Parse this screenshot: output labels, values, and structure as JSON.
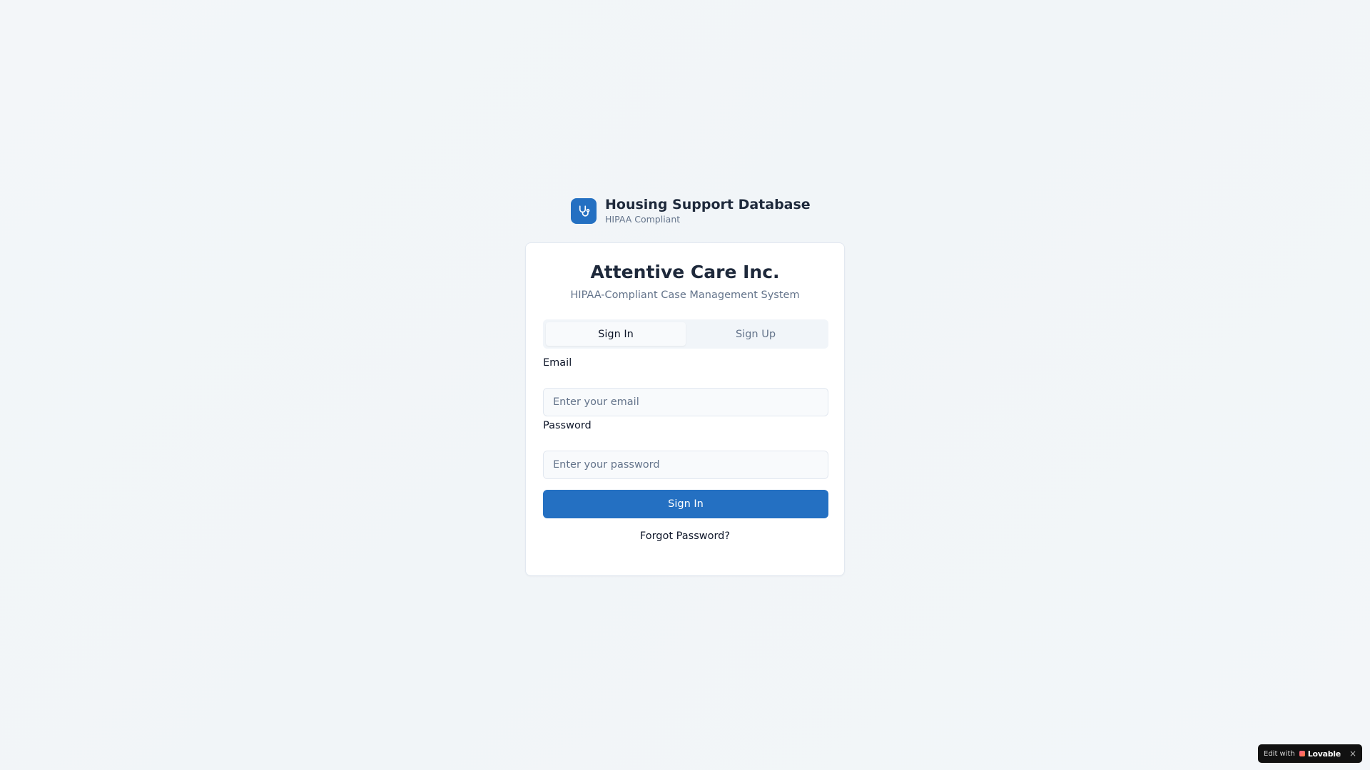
{
  "brand": {
    "icon": "stethoscope-icon",
    "title": "Housing Support Database",
    "subtitle": "HIPAA Compliant"
  },
  "card": {
    "title": "Attentive Care Inc.",
    "subtitle": "HIPAA-Compliant Case Management System"
  },
  "tabs": [
    {
      "label": "Sign In",
      "active": true
    },
    {
      "label": "Sign Up",
      "active": false
    }
  ],
  "form": {
    "email_label": "Email",
    "email_placeholder": "Enter your email",
    "email_value": "",
    "password_label": "Password",
    "password_placeholder": "Enter your password",
    "password_value": "",
    "submit_label": "Sign In",
    "forgot_label": "Forgot Password?"
  },
  "badge": {
    "prefix": "Edit with",
    "brand": "Lovable",
    "close": "×"
  },
  "colors": {
    "primary": "#2470c2",
    "background": "#f1f5f9",
    "muted_text": "#64748b"
  }
}
